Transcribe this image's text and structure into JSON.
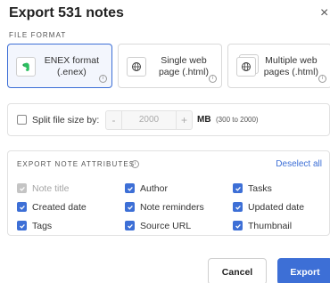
{
  "dialog": {
    "title": "Export 531 notes"
  },
  "file_format": {
    "label": "FILE FORMAT",
    "options": [
      {
        "line1": "ENEX format",
        "line2": "(.enex)",
        "icon": "evernote-icon",
        "selected": true
      },
      {
        "line1": "Single web",
        "line2": "page (.html)",
        "icon": "globe-page-icon",
        "selected": false
      },
      {
        "line1": "Multiple web",
        "line2": "pages (.html)",
        "icon": "globe-pages-icon",
        "selected": false
      }
    ],
    "info_glyph": "i"
  },
  "split": {
    "label": "Split file size by:",
    "checked": false,
    "minus": "-",
    "value": "2000",
    "plus": "+",
    "unit": "MB",
    "range": "(300 to 2000)"
  },
  "attributes": {
    "heading": "EXPORT NOTE ATTRIBUTES",
    "info_glyph": "i",
    "deselect_all": "Deselect all",
    "items": [
      {
        "label": "Note title",
        "checked": true,
        "disabled": true
      },
      {
        "label": "Author",
        "checked": true,
        "disabled": false
      },
      {
        "label": "Tasks",
        "checked": true,
        "disabled": false
      },
      {
        "label": "Created date",
        "checked": true,
        "disabled": false
      },
      {
        "label": "Note reminders",
        "checked": true,
        "disabled": false
      },
      {
        "label": "Updated date",
        "checked": true,
        "disabled": false
      },
      {
        "label": "Tags",
        "checked": true,
        "disabled": false
      },
      {
        "label": "Source URL",
        "checked": true,
        "disabled": false
      },
      {
        "label": "Thumbnail",
        "checked": true,
        "disabled": false
      }
    ]
  },
  "buttons": {
    "cancel": "Cancel",
    "export": "Export"
  },
  "colors": {
    "accent": "#3d6fd6",
    "evernote_green": "#2dbe60",
    "disabled_check": "#c4c4c4"
  }
}
